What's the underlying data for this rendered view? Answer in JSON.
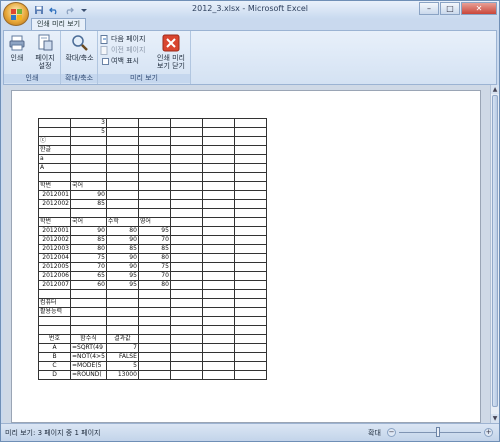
{
  "window": {
    "title": "2012_3.xlsx - Microsoft Excel",
    "controls": [
      "–",
      "□",
      "✕"
    ]
  },
  "quick_access": [
    "save-icon",
    "undo-icon",
    "redo-icon",
    "customize-icon"
  ],
  "ribbon": {
    "tab_label": "인쇄 미리 보기",
    "groups": [
      {
        "label": "인쇄",
        "buttons": [
          "인쇄",
          "페이지 설정"
        ]
      },
      {
        "label": "확대/축소",
        "buttons": [
          "확대/축소"
        ]
      },
      {
        "label": "미리 보기",
        "next_page": "다음 페이지",
        "prev_page": "이전 페이지",
        "show_margins": "여백 표시",
        "close_preview": "인쇄 미리 보기 닫기"
      }
    ]
  },
  "status": {
    "left": "미리 보기: 3 페이지 중 1 페이지",
    "zoom_label": "확대"
  },
  "sheet": {
    "col_count": 7,
    "rows": [
      [
        "",
        "3",
        "",
        "",
        "",
        "",
        ""
      ],
      [
        "",
        "5",
        "",
        "",
        "",
        "",
        ""
      ],
      [
        "ⓒ",
        "",
        "",
        "",
        "",
        "",
        ""
      ],
      [
        "한글",
        "",
        "",
        "",
        "",
        "",
        ""
      ],
      [
        "a",
        "",
        "",
        "",
        "",
        "",
        ""
      ],
      [
        "A",
        "",
        "",
        "",
        "",
        "",
        ""
      ],
      [
        "",
        "",
        "",
        "",
        "",
        "",
        ""
      ],
      [
        "학번",
        "국어",
        "",
        "",
        "",
        "",
        ""
      ],
      [
        "2012001",
        "90",
        "",
        "",
        "",
        "",
        ""
      ],
      [
        "2012002",
        "85",
        "",
        "",
        "",
        "",
        ""
      ],
      [
        "",
        "",
        "",
        "",
        "",
        "",
        ""
      ],
      [
        "학번",
        "국어",
        "수학",
        "영어",
        "",
        "",
        ""
      ],
      [
        "2012001",
        "90",
        "80",
        "95",
        "",
        "",
        ""
      ],
      [
        "2012002",
        "85",
        "90",
        "70",
        "",
        "",
        ""
      ],
      [
        "2012003",
        "80",
        "85",
        "85",
        "",
        "",
        ""
      ],
      [
        "2012004",
        "75",
        "90",
        "80",
        "",
        "",
        ""
      ],
      [
        "2012005",
        "70",
        "90",
        "75",
        "",
        "",
        ""
      ],
      [
        "2012006",
        "65",
        "95",
        "70",
        "",
        "",
        ""
      ],
      [
        "2012007",
        "60",
        "95",
        "80",
        "",
        "",
        ""
      ],
      [
        "",
        "",
        "",
        "",
        "",
        "",
        ""
      ],
      [
        "컴퓨터",
        "",
        "",
        "",
        "",
        "",
        ""
      ],
      [
        "활용능력",
        "",
        "",
        "",
        "",
        "",
        ""
      ],
      [
        "",
        "",
        "",
        "",
        "",
        "",
        ""
      ],
      [
        "",
        "",
        "",
        "",
        "",
        "",
        ""
      ],
      [
        "번호",
        "함수식",
        "결과값",
        "",
        "",
        "",
        ""
      ],
      [
        "A",
        "=SQRT(49",
        "7",
        "",
        "",
        "",
        ""
      ],
      [
        "B",
        "=NOT(4>5",
        "FALSE",
        "",
        "",
        "",
        ""
      ],
      [
        "C",
        "=MODE(5",
        "5",
        "",
        "",
        "",
        ""
      ],
      [
        "D",
        "=ROUND(",
        "13000",
        "",
        "",
        "",
        ""
      ]
    ],
    "align": [
      [
        "",
        "r",
        "",
        "",
        "",
        "",
        ""
      ],
      [
        "",
        "r",
        "",
        "",
        "",
        "",
        ""
      ],
      [
        "",
        "",
        "",
        "",
        "",
        "",
        ""
      ],
      [
        "",
        "",
        "",
        "",
        "",
        "",
        ""
      ],
      [
        "",
        "",
        "",
        "",
        "",
        "",
        ""
      ],
      [
        "",
        "",
        "",
        "",
        "",
        "",
        ""
      ],
      [
        "",
        "",
        "",
        "",
        "",
        "",
        ""
      ],
      [
        "",
        "",
        "",
        "",
        "",
        "",
        ""
      ],
      [
        "r",
        "r",
        "",
        "",
        "",
        "",
        ""
      ],
      [
        "r",
        "r",
        "",
        "",
        "",
        "",
        ""
      ],
      [
        "",
        "",
        "",
        "",
        "",
        "",
        ""
      ],
      [
        "",
        "",
        "",
        "",
        "",
        "",
        ""
      ],
      [
        "r",
        "r",
        "r",
        "r",
        "",
        "",
        ""
      ],
      [
        "r",
        "r",
        "r",
        "r",
        "",
        "",
        ""
      ],
      [
        "r",
        "r",
        "r",
        "r",
        "",
        "",
        ""
      ],
      [
        "r",
        "r",
        "r",
        "r",
        "",
        "",
        ""
      ],
      [
        "r",
        "r",
        "r",
        "r",
        "",
        "",
        ""
      ],
      [
        "r",
        "r",
        "r",
        "r",
        "",
        "",
        ""
      ],
      [
        "r",
        "r",
        "r",
        "r",
        "",
        "",
        ""
      ],
      [
        "",
        "",
        "",
        "",
        "",
        "",
        ""
      ],
      [
        "",
        "",
        "",
        "",
        "",
        "",
        ""
      ],
      [
        "",
        "",
        "",
        "",
        "",
        "",
        ""
      ],
      [
        "",
        "",
        "",
        "",
        "",
        "",
        ""
      ],
      [
        "",
        "",
        "",
        "",
        "",
        "",
        ""
      ],
      [
        "c",
        "c",
        "c",
        "",
        "",
        "",
        ""
      ],
      [
        "c",
        "",
        "r",
        "",
        "",
        "",
        ""
      ],
      [
        "c",
        "",
        "r",
        "",
        "",
        "",
        ""
      ],
      [
        "c",
        "",
        "r",
        "",
        "",
        "",
        ""
      ],
      [
        "c",
        "",
        "r",
        "",
        "",
        "",
        ""
      ]
    ]
  }
}
